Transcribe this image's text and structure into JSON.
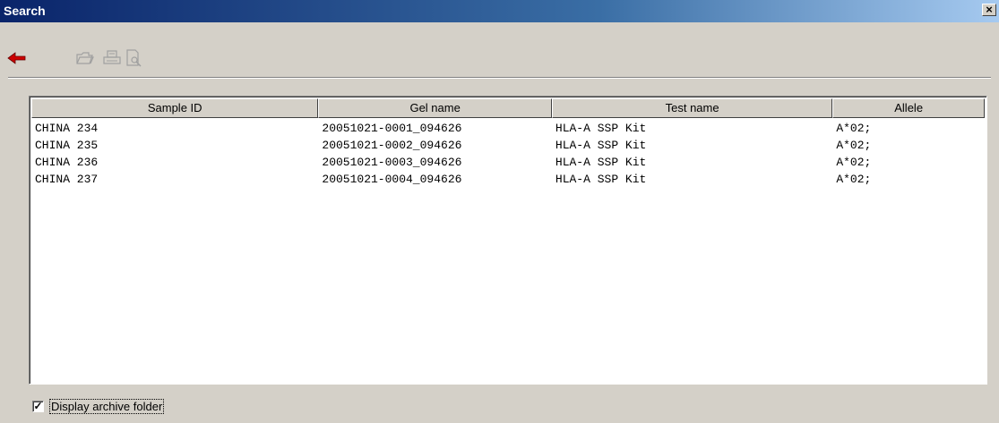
{
  "window": {
    "title": "Search",
    "close_label": "×"
  },
  "toolbar": {
    "buttons": [
      {
        "icon": "back-arrow-icon"
      },
      {
        "icon": "open-folder-icon"
      },
      {
        "icon": "print-icon"
      },
      {
        "icon": "print-preview-icon"
      }
    ]
  },
  "table": {
    "columns": [
      "Sample ID",
      "Gel name",
      "Test name",
      "Allele"
    ],
    "rows": [
      [
        "CHINA 234",
        "20051021-0001_094626",
        "HLA-A SSP Kit",
        "A*02;"
      ],
      [
        "CHINA 235",
        "20051021-0002_094626",
        "HLA-A SSP Kit",
        "A*02;"
      ],
      [
        "CHINA 236",
        "20051021-0003_094626",
        "HLA-A SSP Kit",
        "A*02;"
      ],
      [
        "CHINA 237",
        "20051021-0004_094626",
        "HLA-A SSP Kit",
        "A*02;"
      ]
    ]
  },
  "footer": {
    "checkbox_label": "Display archive folder",
    "checked": true
  },
  "colors": {
    "titlebar_start": "#0a246a",
    "back_arrow": "#cc0000",
    "face": "#d4d0c8"
  }
}
